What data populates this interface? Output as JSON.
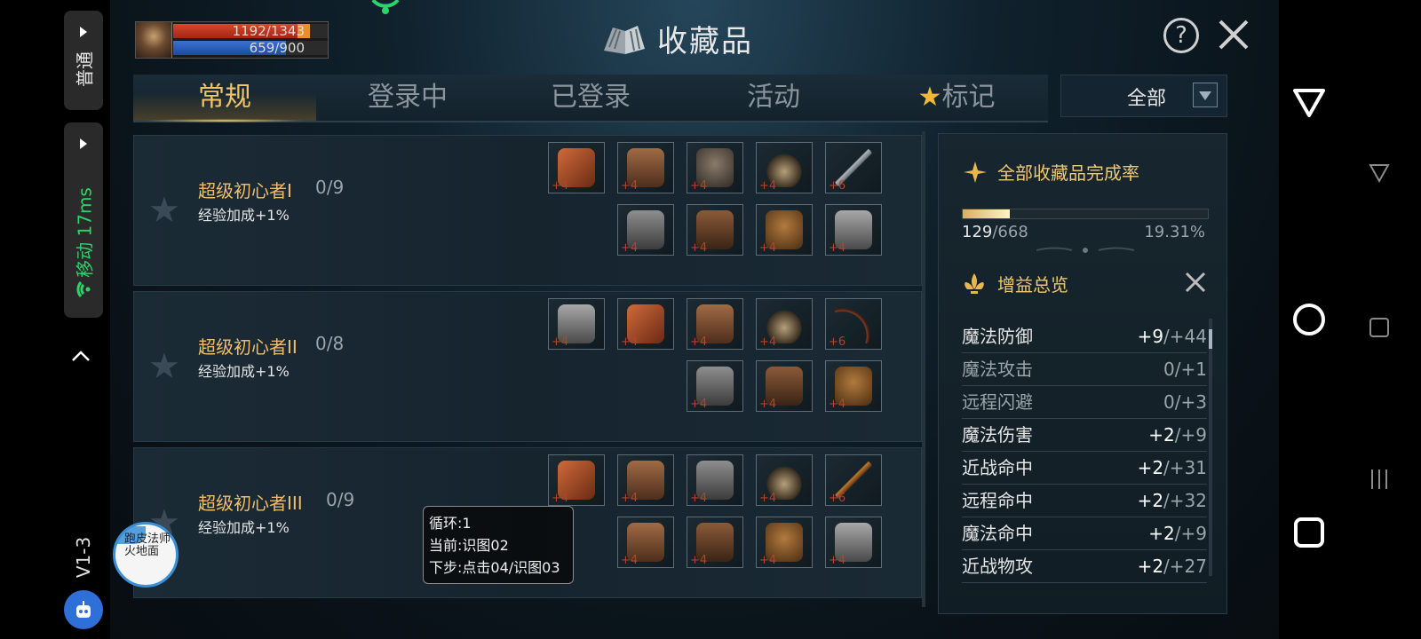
{
  "overlay": {
    "mode_label": "普通",
    "network_label": "移动 17ms",
    "version": "V1-3",
    "float_ball_text": "跑皮法师火地面"
  },
  "player": {
    "hp_text": "1192/1343",
    "hp_ratio": 0.887,
    "mp_text": "659/900",
    "mp_ratio": 0.732
  },
  "header": {
    "title": "收藏品",
    "help_label": "?"
  },
  "tabs": [
    {
      "label": "常规",
      "active": true
    },
    {
      "label": "登录中",
      "active": false
    },
    {
      "label": "已登录",
      "active": false
    },
    {
      "label": "活动",
      "active": false
    },
    {
      "label": "标记",
      "active": false,
      "icon": "star-icon"
    }
  ],
  "filter": {
    "selected": "全部"
  },
  "collections": [
    {
      "name": "超级初心者I",
      "progress": "0/9",
      "bonus": "经验加成+1%",
      "items_top": [
        {
          "icon": "glove",
          "level": "+4"
        },
        {
          "icon": "cloak",
          "level": "+4"
        },
        {
          "icon": "helm",
          "level": "+4"
        },
        {
          "icon": "horn",
          "level": "+4"
        },
        {
          "icon": "sword",
          "level": "+6"
        }
      ],
      "items_bottom": [
        {
          "icon": "chest",
          "level": "+4"
        },
        {
          "icon": "boot",
          "level": "+4"
        },
        {
          "icon": "belt",
          "level": "+4"
        },
        {
          "icon": "mail",
          "level": "+4"
        }
      ]
    },
    {
      "name": "超级初心者II",
      "progress": "0/8",
      "bonus": "经验加成+1%",
      "items_top": [
        {
          "icon": "mail",
          "level": "+4"
        },
        {
          "icon": "glove",
          "level": "+4"
        },
        {
          "icon": "cloak",
          "level": "+4"
        },
        {
          "icon": "horn",
          "level": "+4"
        },
        {
          "icon": "bow",
          "level": "+6"
        }
      ],
      "items_bottom": [
        {
          "icon": "chest",
          "level": "+4"
        },
        {
          "icon": "boot",
          "level": "+4"
        },
        {
          "icon": "belt",
          "level": "+4"
        }
      ]
    },
    {
      "name": "超级初心者III",
      "progress": "0/9",
      "bonus": "经验加成+1%",
      "items_top": [
        {
          "icon": "glove",
          "level": "+4"
        },
        {
          "icon": "cloak",
          "level": "+4"
        },
        {
          "icon": "chest",
          "level": "+4"
        },
        {
          "icon": "horn",
          "level": "+4"
        },
        {
          "icon": "staff",
          "level": "+6"
        }
      ],
      "items_bottom": [
        {
          "icon": "cloak",
          "level": "+4"
        },
        {
          "icon": "boot",
          "level": "+4"
        },
        {
          "icon": "belt",
          "level": "+4"
        },
        {
          "icon": "mail",
          "level": "+4"
        }
      ]
    }
  ],
  "tooltip": {
    "line1": "循环:1",
    "line2": "当前:识图02",
    "line3": "下步:点击04/识图03"
  },
  "completion": {
    "title": "全部收藏品完成率",
    "collected": "129",
    "total": "/668",
    "percent": "19.31%",
    "ratio": 0.1931
  },
  "buffs": {
    "title": "增益总览",
    "items": [
      {
        "name": "魔法防御",
        "current": "+9",
        "max": "/+44",
        "dim": false
      },
      {
        "name": "魔法攻击",
        "current": "0",
        "max": "/+1",
        "dim": true
      },
      {
        "name": "远程闪避",
        "current": "0",
        "max": "/+3",
        "dim": true
      },
      {
        "name": "魔法伤害",
        "current": "+2",
        "max": "/+9",
        "dim": false
      },
      {
        "name": "近战命中",
        "current": "+2",
        "max": "/+31",
        "dim": false
      },
      {
        "name": "远程命中",
        "current": "+2",
        "max": "/+32",
        "dim": false
      },
      {
        "name": "魔法命中",
        "current": "+2",
        "max": "/+9",
        "dim": false
      },
      {
        "name": "近战物攻",
        "current": "+2",
        "max": "/+27",
        "dim": false
      }
    ]
  },
  "colors": {
    "accent_gold": "#f2c467",
    "name_gold": "#f0be6a",
    "level_red": "#b8402c",
    "network_green": "#2bd56a"
  }
}
